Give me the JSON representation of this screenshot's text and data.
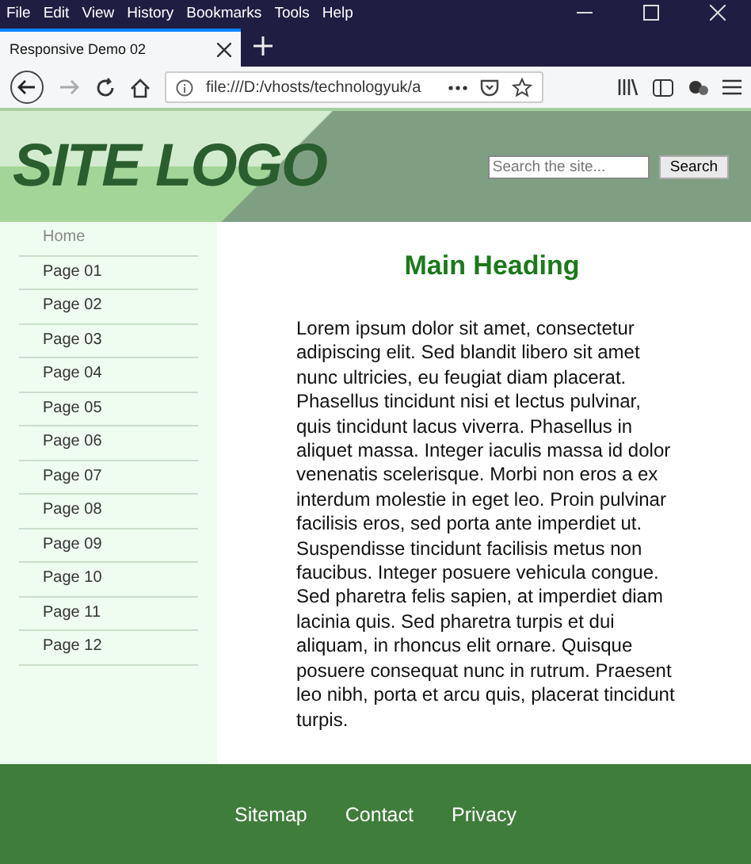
{
  "menu_bar": [
    "File",
    "Edit",
    "View",
    "History",
    "Bookmarks",
    "Tools",
    "Help"
  ],
  "tabs": [
    {
      "label": "Responsive Demo 02",
      "selected": true
    }
  ],
  "address_bar": {
    "value": "file:///D:/vhosts/technologyuk/a"
  },
  "header": {
    "logo": "SITE LOGO",
    "search": {
      "placeholder": "Search the site...",
      "button": "Search"
    }
  },
  "sidebar": {
    "items": [
      {
        "label": "Home",
        "selected": true
      },
      {
        "label": "Page 01",
        "selected": false
      },
      {
        "label": "Page 02",
        "selected": false
      },
      {
        "label": "Page 03",
        "selected": false
      },
      {
        "label": "Page 04",
        "selected": false
      },
      {
        "label": "Page 05",
        "selected": false
      },
      {
        "label": "Page 06",
        "selected": false
      },
      {
        "label": "Page 07",
        "selected": false
      },
      {
        "label": "Page 08",
        "selected": false
      },
      {
        "label": "Page 09",
        "selected": false
      },
      {
        "label": "Page 10",
        "selected": false
      },
      {
        "label": "Page 11",
        "selected": false
      },
      {
        "label": "Page 12",
        "selected": false
      }
    ]
  },
  "main": {
    "heading": "Main Heading",
    "paragraph": "Lorem ipsum dolor sit amet, consectetur adipiscing elit. Sed blandit libero sit amet nunc ultricies, eu feugiat diam placerat. Phasellus tincidunt nisi et lectus pulvinar, quis tincidunt lacus viverra. Phasellus in aliquet massa. Integer iaculis massa id dolor venenatis scelerisque. Morbi non eros a ex interdum molestie in eget leo. Proin pulvinar facilisis eros, sed porta ante imperdiet ut. Suspendisse tincidunt facilisis metus non faucibus. Integer posuere vehicula congue. Sed pharetra felis sapien, at imperdiet diam lacinia quis. Sed pharetra turpis et dui aliquam, in rhoncus elit ornare. Quisque posuere consequat nunc in rutrum. Praesent leo nibh, porta et arcu quis, placerat tincidunt turpis."
  },
  "footer": {
    "links": [
      "Sitemap",
      "Contact",
      "Privacy"
    ]
  }
}
